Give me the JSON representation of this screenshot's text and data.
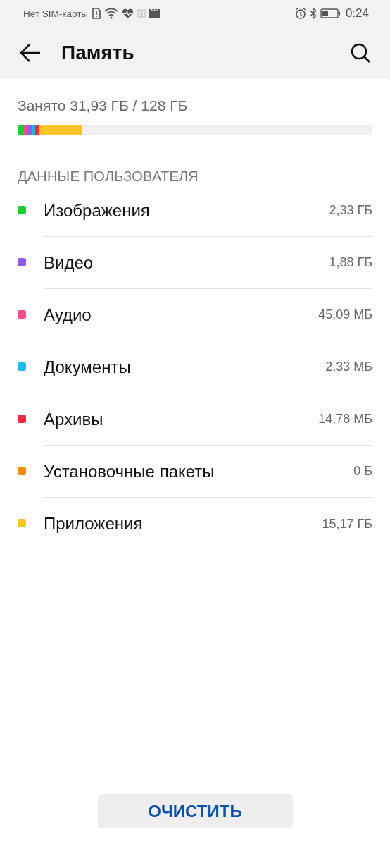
{
  "status_bar": {
    "carrier": "Нет SIM-карты",
    "time": "0:24"
  },
  "header": {
    "title": "Память"
  },
  "summary": "Занято 31,93 ГБ / 128 ГБ",
  "usage_bar": {
    "segments": [
      {
        "color": "#1ecb2e",
        "level": 0.018
      },
      {
        "color": "#f0508c",
        "level": 0.01
      },
      {
        "color": "#8f5cf0",
        "level": 0.014
      },
      {
        "color": "#20b8e8",
        "level": 0.008
      },
      {
        "color": "#f5283c",
        "level": 0.012
      },
      {
        "color": "#fec22a",
        "level": 0.119
      }
    ]
  },
  "section_title": "ДАННЫЕ ПОЛЬЗОВАТЕЛЯ",
  "items": [
    {
      "label": "Изображения",
      "size": "2,33 ГБ",
      "color": "#1ecb2e"
    },
    {
      "label": "Видео",
      "size": "1,88 ГБ",
      "color": "#8f5cf0"
    },
    {
      "label": "Аудио",
      "size": "45,09 МБ",
      "color": "#f0508c"
    },
    {
      "label": "Документы",
      "size": "2,33 МБ",
      "color": "#20b8e8"
    },
    {
      "label": "Архивы",
      "size": "14,78 МБ",
      "color": "#f5283c"
    },
    {
      "label": "Установочные пакеты",
      "size": "0 Б",
      "color": "#fb8a0c"
    },
    {
      "label": "Приложения",
      "size": "15,17 ГБ",
      "color": "#fec22a"
    }
  ],
  "clear_button": "ОЧИСТИТЬ"
}
